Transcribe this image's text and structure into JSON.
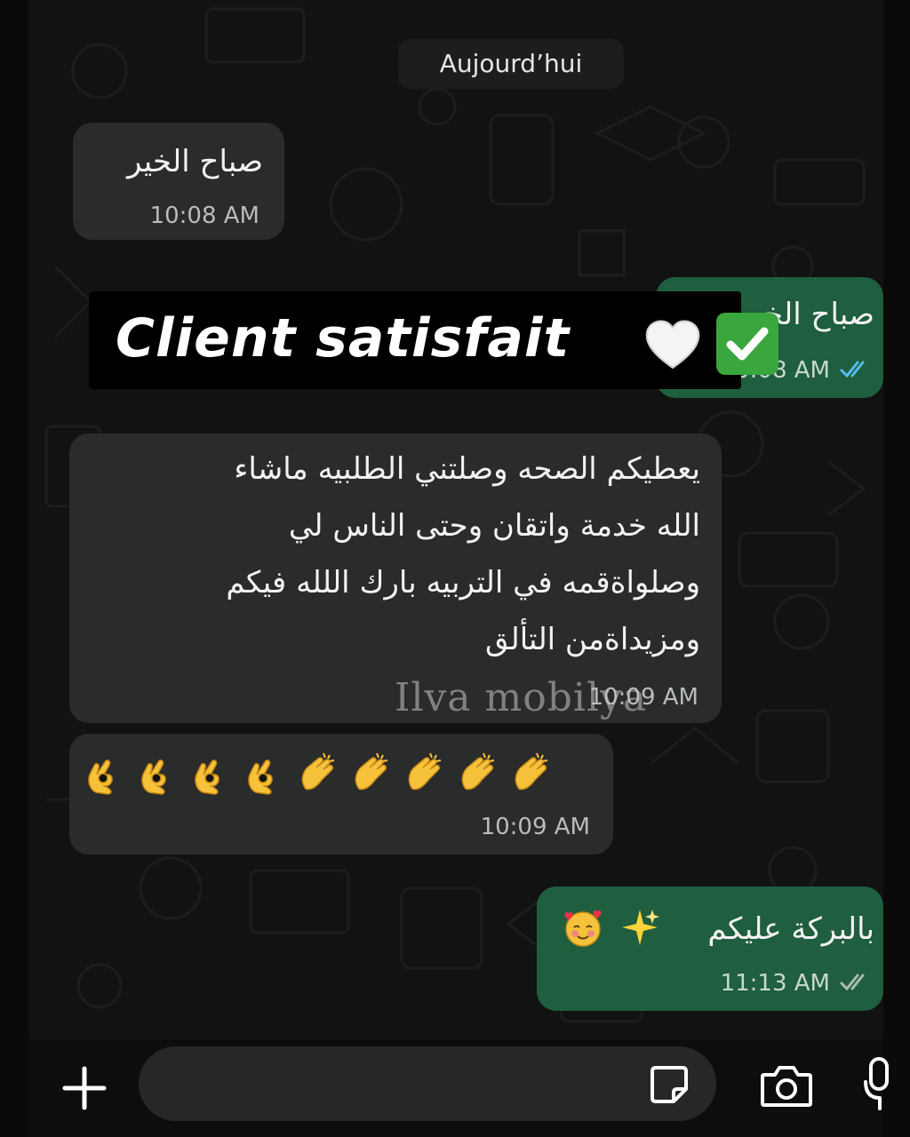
{
  "date_separator": "Aujourd’hui",
  "messages": [
    {
      "direction": "in",
      "text": "صباح الخير",
      "time": "10:08 AM"
    },
    {
      "direction": "out",
      "text": "صباح الخير",
      "time": "10:08 AM",
      "status": "read"
    },
    {
      "direction": "in",
      "lines": [
        "يعطيكم الصحه وصلتني الطلبيه ماشاء",
        "الله خدمة واتقان  وحتى الناس لي",
        "وصلواةقمه في التربيه بارك اللله فيكم",
        "ومزيداةمن التألق"
      ],
      "time": "10:09 AM"
    },
    {
      "direction": "in",
      "emojis": [
        "ok-hand",
        "ok-hand",
        "ok-hand",
        "ok-hand",
        "clapping-hands",
        "clapping-hands",
        "clapping-hands",
        "clapping-hands",
        "clapping-hands"
      ],
      "time": "10:09 AM"
    },
    {
      "direction": "out",
      "text": "بالبركة عليكم",
      "emojis": [
        "sparkles",
        "smiling-face-with-hearts"
      ],
      "time": "11:13 AM",
      "status": "read"
    }
  ],
  "banner": {
    "text": "Client satisfait",
    "emojis": [
      "white-heart",
      "check-mark-button"
    ]
  },
  "watermark": "Ilva mobilya",
  "composer": {
    "icons": [
      "plus-icon",
      "sticker-icon",
      "camera-icon",
      "microphone-icon"
    ]
  },
  "colors": {
    "incoming_bubble": "#2a2b2b",
    "outgoing_bubble": "#1f5e3e",
    "background": "#111212",
    "read_ticks": "#53bdeb"
  }
}
